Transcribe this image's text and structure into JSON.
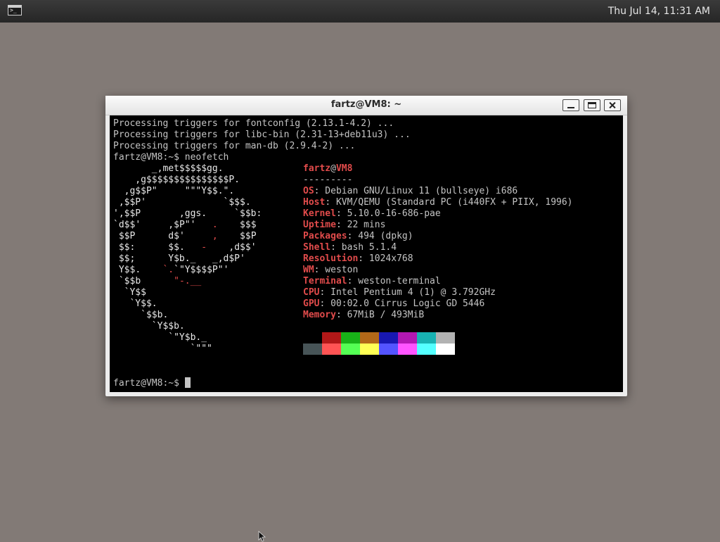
{
  "panel": {
    "launcher_icon": "terminal-icon",
    "clock": "Thu Jul 14, 11:31 AM"
  },
  "window": {
    "title": "fartz@VM8: ~",
    "buttons": [
      "minimize-icon",
      "maximize-icon",
      "close-icon"
    ]
  },
  "terminal": {
    "output_lines": [
      "Processing triggers for fontconfig (2.13.1-4.2) ...",
      "Processing triggers for libc-bin (2.31-13+deb11u3) ...",
      "Processing triggers for man-db (2.9.4-2) ...",
      "fartz@VM8:~$ neofetch"
    ],
    "logo": [
      "       _,met$$$$$gg.",
      "    ,g$$$$$$$$$$$$$$$P.",
      "  ,g$$P\"     \"\"\"Y$$.\".",
      " ,$$P'              `$$$.",
      "',$$P       ,ggs.     `$$b:",
      "`d$$'     ,$P\"'   .    $$$",
      " $$P      d$'     ,    $$P",
      " $$:      $$.   -    ,d$$'",
      " $$;      Y$b._   _,d$P'",
      " Y$$.    `.`\"Y$$$$P\"'",
      " `$$b      \"-.__",
      "  `Y$$",
      "   `Y$$.",
      "     `$$b.",
      "       `Y$$b.",
      "          `\"Y$b._",
      "              `\"\"\""
    ],
    "info": {
      "user": "fartz",
      "at": "@",
      "host": "VM8",
      "separator": "---------",
      "fields": [
        {
          "key": "OS",
          "value": ": Debian GNU/Linux 11 (bullseye) i686"
        },
        {
          "key": "Host",
          "value": ": KVM/QEMU (Standard PC (i440FX + PIIX, 1996)"
        },
        {
          "key": "Kernel",
          "value": ": 5.10.0-16-686-pae"
        },
        {
          "key": "Uptime",
          "value": ": 22 mins"
        },
        {
          "key": "Packages",
          "value": ": 494 (dpkg)"
        },
        {
          "key": "Shell",
          "value": ": bash 5.1.4"
        },
        {
          "key": "Resolution",
          "value": ": 1024x768"
        },
        {
          "key": "WM",
          "value": ": weston"
        },
        {
          "key": "Terminal",
          "value": ": weston-terminal"
        },
        {
          "key": "CPU",
          "value": ": Intel Pentium 4 (1) @ 3.792GHz"
        },
        {
          "key": "GPU",
          "value": ": 00:02.0 Cirrus Logic GD 5446"
        },
        {
          "key": "Memory",
          "value": ": 67MiB / 493MiB"
        }
      ]
    },
    "palette_normal": [
      "#000000",
      "#b21818",
      "#18b218",
      "#b26818",
      "#1818b2",
      "#b218b2",
      "#18b2b2",
      "#b2b2b2"
    ],
    "palette_bright": [
      "#475457",
      "#ff5454",
      "#54ff54",
      "#ffff54",
      "#5454ff",
      "#ff54ff",
      "#54ffff",
      "#ffffff"
    ],
    "prompt": "fartz@VM8:~$ "
  }
}
